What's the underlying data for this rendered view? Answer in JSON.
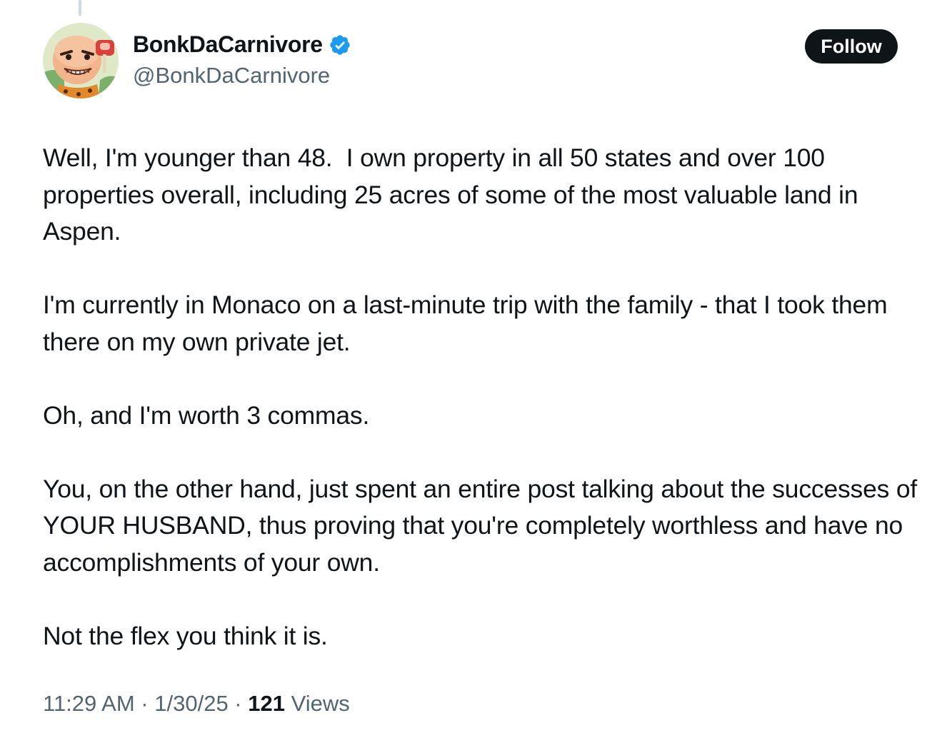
{
  "author": {
    "display_name": "BonkDaCarnivore",
    "handle": "@BonkDaCarnivore",
    "verified": true,
    "verified_color": "#1d9bf0",
    "avatar_icon": "bonk-caveman-avatar"
  },
  "follow_button": {
    "label": "Follow"
  },
  "tweet": {
    "paragraphs": [
      "Well, I'm younger than 48.  I own property in all 50 states and over 100 properties overall, including 25 acres of some of the most valuable land in Aspen.",
      "I'm currently in Monaco on a last-minute trip with the family - that I took them there on my own private jet.",
      "Oh, and I'm worth 3 commas.",
      "You, on the other hand, just spent an entire post talking about the successes of YOUR HUSBAND, thus proving that you're completely worthless and have no accomplishments of your own.",
      "Not the flex you think it is."
    ]
  },
  "meta": {
    "time": "11:29 AM",
    "separator": " · ",
    "date": "1/30/25",
    "views_count": "121",
    "views_label": " Views"
  }
}
